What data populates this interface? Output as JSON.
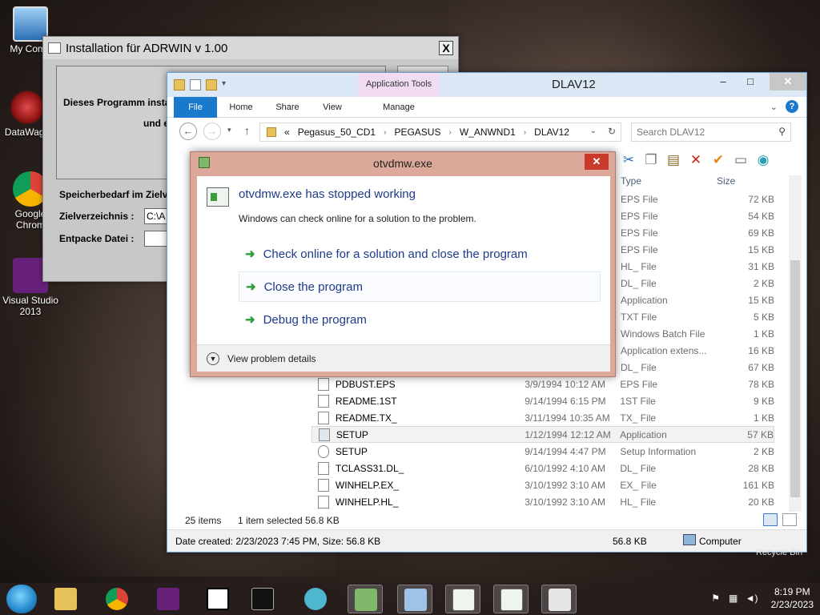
{
  "desktop": {
    "icons": [
      {
        "label": "My Comp"
      },
      {
        "label": "DataWage"
      },
      {
        "label": "Google Chrom"
      },
      {
        "label": "Visual Studio 2013"
      }
    ],
    "recycle_label": "Recycle Bin"
  },
  "installer": {
    "title": "Installation für ADRWIN v 1.00",
    "close": "X",
    "panel_text1": "Dieses Programm instal",
    "panel_text2": "und e",
    "speicher": "Speicherbedarf im Zielv",
    "ziel_label": "Zielverzeichnis :",
    "ziel_value": "C:\\A",
    "entpacke_label": "Entpacke Datei :"
  },
  "explorer": {
    "title": "DLAV12",
    "app_tools": "Application Tools",
    "tabs": {
      "file": "File",
      "home": "Home",
      "share": "Share",
      "view": "View",
      "manage": "Manage"
    },
    "path": [
      "«",
      "Pegasus_50_CD1",
      "PEGASUS",
      "W_ANWND1",
      "DLAV12"
    ],
    "search_placeholder": "Search DLAV12",
    "columns": {
      "type": "Type",
      "size": "Size"
    },
    "upper_rows": [
      {
        "type": "EPS File",
        "size": "72 KB"
      },
      {
        "type": "EPS File",
        "size": "54 KB"
      },
      {
        "type": "EPS File",
        "size": "69 KB"
      },
      {
        "type": "EPS File",
        "size": "15 KB"
      },
      {
        "type": "HL_ File",
        "size": "31 KB"
      },
      {
        "type": "DL_ File",
        "size": "2 KB"
      },
      {
        "type": "Application",
        "size": "15 KB"
      },
      {
        "type": "TXT File",
        "size": "5 KB"
      },
      {
        "type": "Windows Batch File",
        "size": "1 KB"
      },
      {
        "type": "Application extens...",
        "size": "16 KB"
      },
      {
        "type": "DL_ File",
        "size": "67 KB"
      }
    ],
    "rows": [
      {
        "name": "PDBUST.EPS",
        "date": "3/9/1994 10:12 AM",
        "type": "EPS File",
        "size": "78 KB"
      },
      {
        "name": "README.1ST",
        "date": "9/14/1994 6:15 PM",
        "type": "1ST File",
        "size": "9 KB"
      },
      {
        "name": "README.TX_",
        "date": "3/11/1994 10:35 AM",
        "type": "TX_ File",
        "size": "1 KB"
      },
      {
        "name": "SETUP",
        "date": "1/12/1994 12:12 AM",
        "type": "Application",
        "size": "57 KB"
      },
      {
        "name": "SETUP",
        "date": "9/14/1994 4:47 PM",
        "type": "Setup Information",
        "size": "2 KB"
      },
      {
        "name": "TCLASS31.DL_",
        "date": "6/10/1992 4:10 AM",
        "type": "DL_ File",
        "size": "28 KB"
      },
      {
        "name": "WINHELP.EX_",
        "date": "3/10/1992 3:10 AM",
        "type": "EX_ File",
        "size": "161 KB"
      },
      {
        "name": "WINHELP.HL_",
        "date": "3/10/1992 3:10 AM",
        "type": "HL_ File",
        "size": "20 KB"
      }
    ],
    "status_items": "25 items",
    "status_selected": "1 item selected  56.8 KB",
    "details_left": "Date created: 2/23/2023 7:45 PM, Size: 56.8 KB",
    "details_size": "56.8 KB",
    "details_location": "Computer"
  },
  "dialog": {
    "title": "otvdmw.exe",
    "heading": "otvdmw.exe has stopped working",
    "subtext": "Windows can check online for a solution to the problem.",
    "options": [
      "Check online for a solution and close the program",
      "Close the program",
      "Debug the program"
    ],
    "footer": "View problem details"
  },
  "taskbar": {
    "time": "8:19 PM",
    "date": "2/23/2023"
  },
  "colors": {
    "explorer_accent": "#1979ca",
    "dialog_frame": "#dca89a",
    "link_blue": "#1e3a8a",
    "arrow_green": "#2a9d3a"
  }
}
